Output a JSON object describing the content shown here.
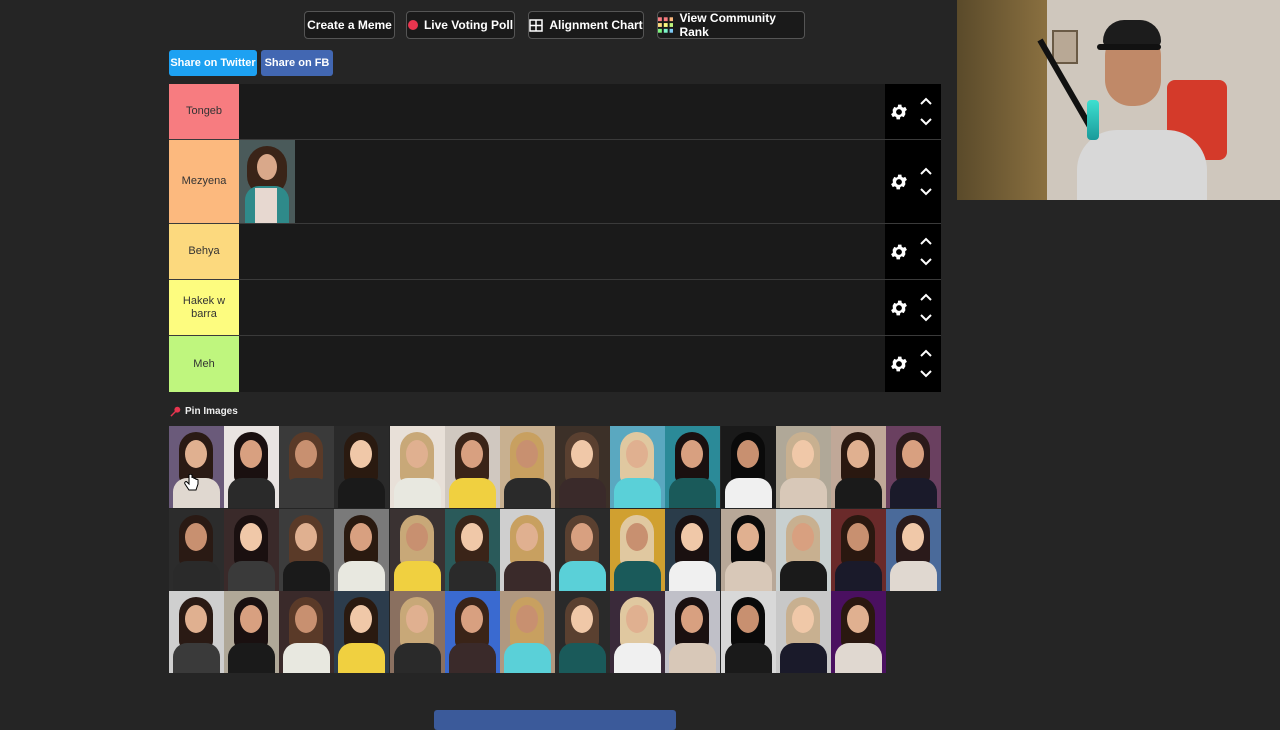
{
  "toolbar": {
    "create_meme": "Create a Meme",
    "live_voting": "Live Voting Poll",
    "alignment_chart": "Alignment Chart",
    "community_rank": "View Community Rank"
  },
  "share": {
    "twitter": "Share on Twitter",
    "fb": "Share on FB"
  },
  "tiers": [
    {
      "label": "Tongeb",
      "color": "#f77c80"
    },
    {
      "label": "Mezyena",
      "color": "#fcb97e"
    },
    {
      "label": "Behya",
      "color": "#fcd97e"
    },
    {
      "label": "Hakek w barra",
      "color": "#fdfc7f"
    },
    {
      "label": "Meh",
      "color": "#bff67e"
    }
  ],
  "pin_images": {
    "label": "Pin Images",
    "icon": "pushpin-icon"
  },
  "colors": {
    "twitter": "#1da1f2",
    "facebook": "#4267b2",
    "live_dot": "#e8354f"
  }
}
